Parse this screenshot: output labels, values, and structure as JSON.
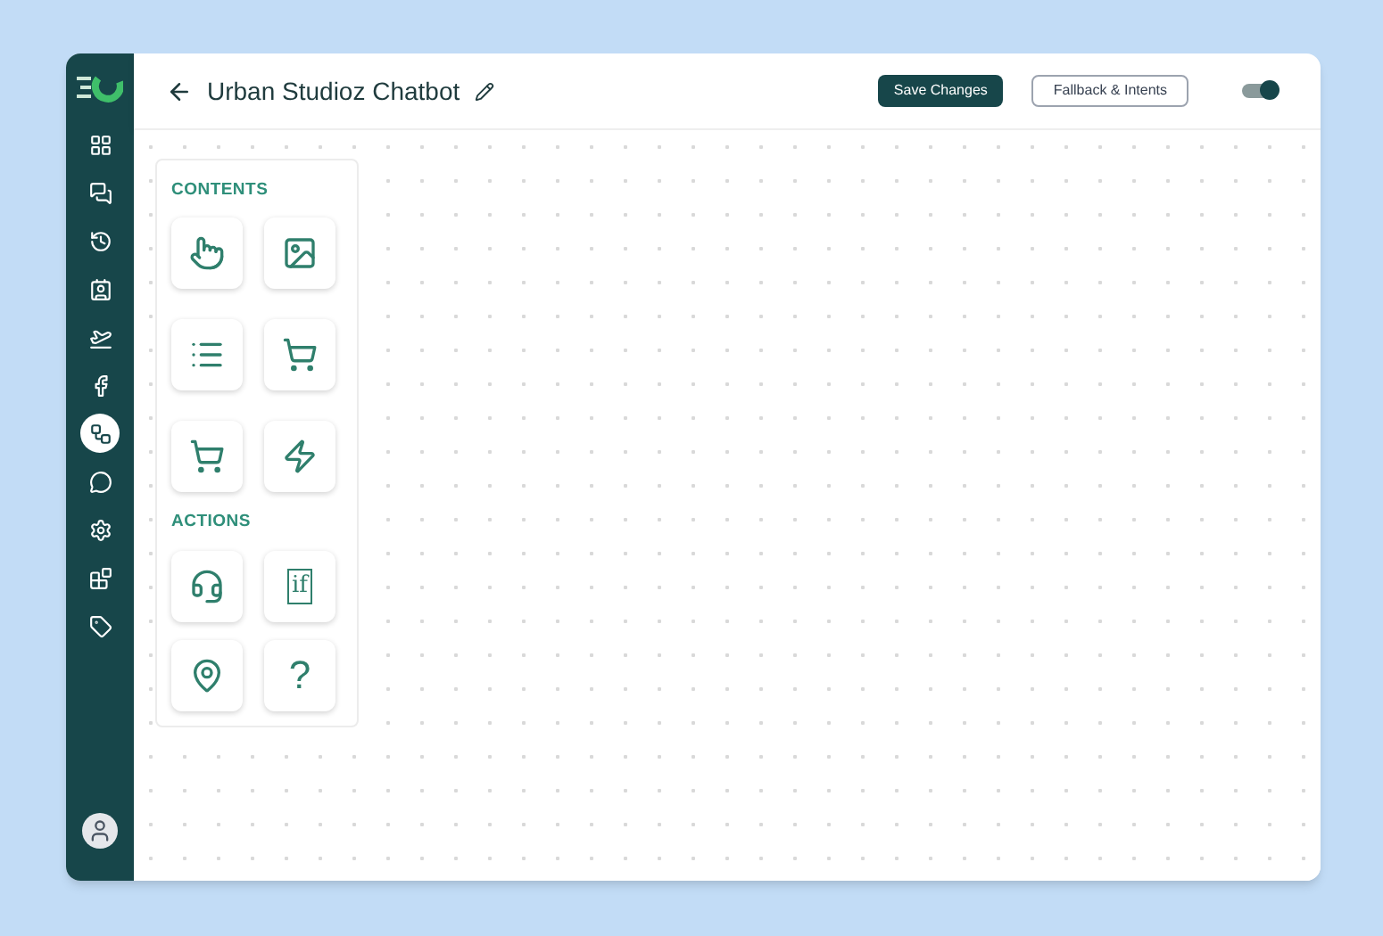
{
  "header": {
    "title": "Urban Studioz Chatbot",
    "buttons": [
      {
        "label": "Save Changes",
        "kind": "primary"
      },
      {
        "label": "Fallback & Intents",
        "kind": "outline"
      }
    ],
    "toggle": {
      "on": true
    }
  },
  "sidebar": {
    "items": [
      {
        "selected": false
      },
      {
        "selected": false
      },
      {
        "selected": false
      },
      {
        "selected": false
      },
      {
        "selected": false
      },
      {
        "selected": false
      },
      {
        "selected": true
      },
      {
        "selected": false
      },
      {
        "selected": false
      },
      {
        "selected": false
      },
      {
        "selected": false
      }
    ]
  },
  "palette": {
    "sections": [
      {
        "title": "CONTENTS",
        "items": [
          {
            "kind": "icon"
          },
          {
            "kind": "icon"
          },
          {
            "kind": "icon"
          },
          {
            "kind": "icon"
          },
          {
            "kind": "icon"
          },
          {
            "kind": "icon"
          }
        ]
      },
      {
        "title": "ACTIONS",
        "items": [
          {
            "kind": "icon"
          },
          {
            "kind": "glyph",
            "glyph": "if"
          },
          {
            "kind": "icon"
          },
          {
            "kind": "glyph",
            "glyph": "?"
          }
        ]
      }
    ]
  }
}
